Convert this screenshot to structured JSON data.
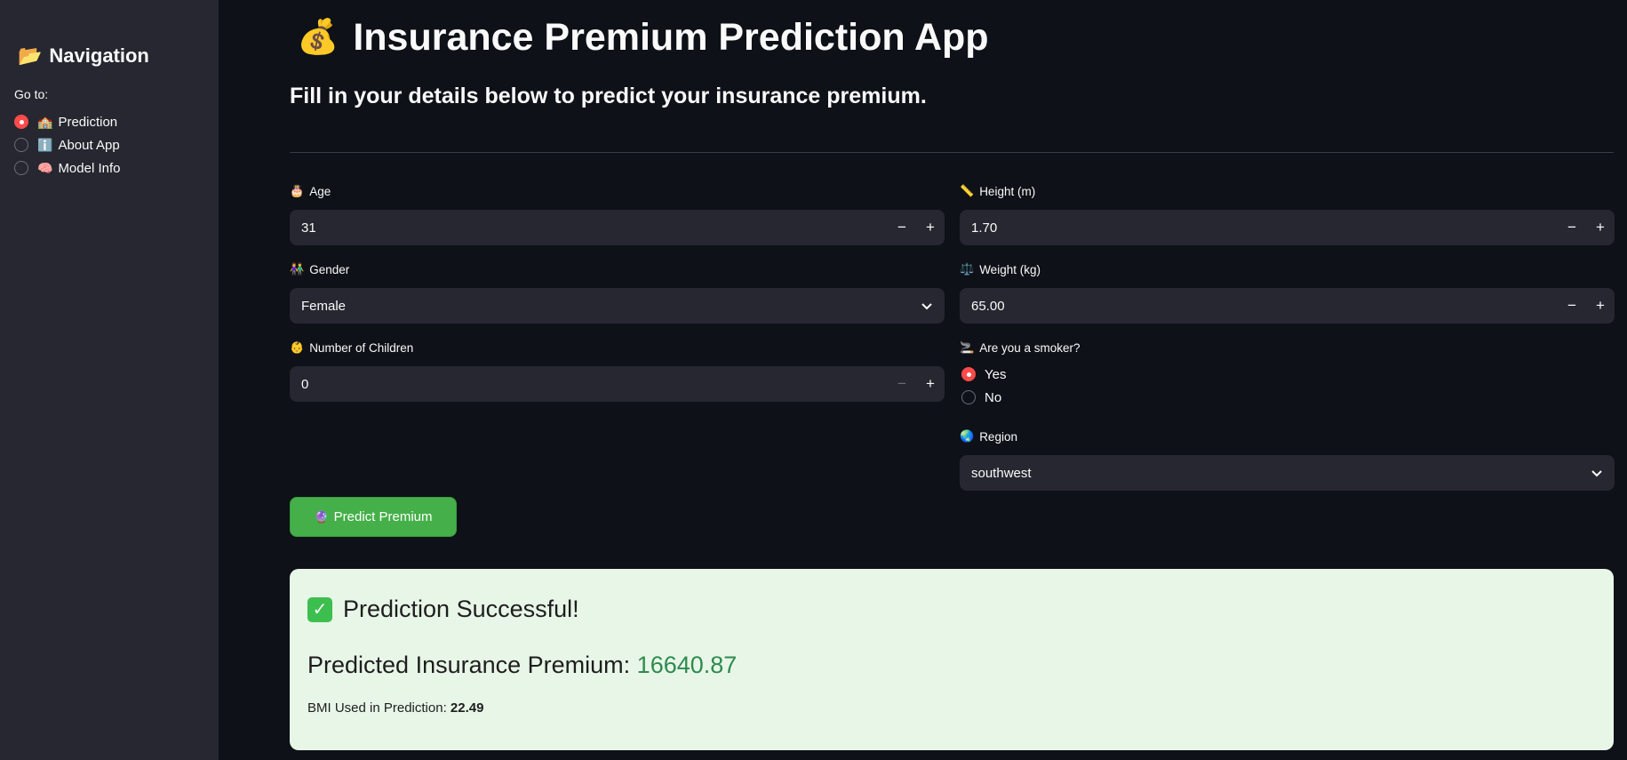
{
  "sidebar": {
    "title_emoji": "📂",
    "title": "Navigation",
    "goto_label": "Go to:",
    "options": [
      {
        "emoji": "🏫",
        "label": "Prediction",
        "selected": true
      },
      {
        "emoji": "ℹ️",
        "label": "About App",
        "selected": false
      },
      {
        "emoji": "🧠",
        "label": "Model Info",
        "selected": false
      }
    ]
  },
  "header": {
    "title_emoji": "💰",
    "title": "Insurance Premium Prediction App",
    "subtitle": "Fill in your details below to predict your insurance premium."
  },
  "form": {
    "age": {
      "emoji": "🎂",
      "label": "Age",
      "value": "31"
    },
    "height": {
      "emoji": "📏",
      "label": "Height (m)",
      "value": "1.70"
    },
    "gender": {
      "emoji": "👫",
      "label": "Gender",
      "value": "Female"
    },
    "weight": {
      "emoji": "⚖️",
      "label": "Weight (kg)",
      "value": "65.00"
    },
    "children": {
      "emoji": "👶",
      "label": "Number of Children",
      "value": "0"
    },
    "smoker": {
      "emoji": "🚬",
      "label": "Are you a smoker?",
      "options": [
        "Yes",
        "No"
      ],
      "selected": "Yes"
    },
    "region": {
      "emoji": "🌏",
      "label": "Region",
      "value": "southwest"
    },
    "minus": "−",
    "plus": "+"
  },
  "predict_button": {
    "emoji": "🔮",
    "label": "Predict Premium"
  },
  "result": {
    "check": "✓",
    "heading": "Prediction Successful!",
    "premium_label": "Predicted Insurance Premium:",
    "premium_value": "16640.87",
    "bmi_label": "BMI Used in Prediction:",
    "bmi_value": "22.49"
  },
  "colors": {
    "accent": "#ff4b4b",
    "button": "#45b049",
    "success_bg": "#e8f6e8",
    "premium_value": "#2e8b4e"
  }
}
